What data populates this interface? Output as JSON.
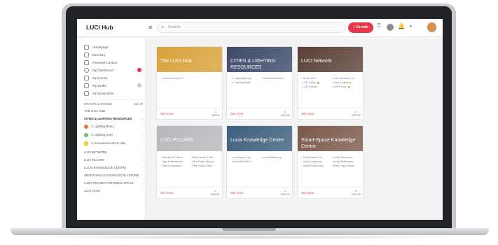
{
  "header": {
    "brand": "LUCI Hub",
    "search_placeholder": "Search",
    "create_label": "+ Create"
  },
  "sidebar": {
    "nav": [
      {
        "label": "Homepage"
      },
      {
        "label": "Directory"
      },
      {
        "label": "Personal Content"
      },
      {
        "label": "My Dashboard"
      },
      {
        "label": "My Events"
      },
      {
        "label": "My Drafts"
      },
      {
        "label": "My Bookmarks"
      }
    ],
    "groups_header": "GROUPS & SPACES",
    "groups_see_all": "See All",
    "groups": [
      {
        "label": "THE LUCI HUB"
      },
      {
        "label": "CITIES & LIGHTING RESOURCES"
      },
      {
        "label": "1. Lighting library"
      },
      {
        "label": "2. Lighting news"
      },
      {
        "label": "3. Announcements & calls"
      },
      {
        "label": "LUCI NETWORK"
      },
      {
        "label": "LUCI PILLARS"
      },
      {
        "label": "LUCIA KNOWLEDGE CENTRE"
      },
      {
        "label": "SMART-SPACE KNOWLEDGE CENTRE"
      },
      {
        "label": "LAB'S PROJECT INTERNAL SPACE"
      },
      {
        "label": "LUCI TEAM"
      }
    ]
  },
  "cards": [
    {
      "title": "The LUCI Hub",
      "links": [
        "- How to use the LU..."
      ],
      "see_more": "See more",
      "spaces_count": "1",
      "spaces_label": "SPACE",
      "color": "#d8a23b"
    },
    {
      "title": "CITIES & LIGHTING RESOURCES",
      "links": [
        "- 1. Lighting library",
        "- 3. Announcements...",
        "- 2. Lighting news"
      ],
      "see_more": "See more",
      "spaces_count": "3",
      "spaces_label": "SPACES",
      "color": "#3c4a6a"
    },
    {
      "title": "LUCI Network",
      "links": [
        "- About LUCI",
        "- LUCI Executive Co...",
        "- LUCI Lights 🔒",
        "- Cities & Lighting...",
        "- LUCI Events",
        "- LIGHT Team 🔒"
      ],
      "see_more": "See more",
      "spaces_count": "6",
      "spaces_label": "SPACES",
      "color": "#5b4037"
    },
    {
      "title": "LUCI PILLARS",
      "links": [
        "- Pillar Art & Culture",
        "- Pillar Health & Wel...",
        "- Light Festivals Wo...",
        "- Pillar Public Spaces",
        "- Pillar Governance",
        "- Pillar Social Cities..."
      ],
      "see_more": "See more",
      "spaces_count": "6",
      "spaces_label": "SPACES",
      "color": "#b8b8bc"
    },
    {
      "title": "Lucia Knowledge Centre",
      "links": [
        "- Lucia News & pr...",
        "- Lucia Partners sp...",
        "- Lucia Wiki Peer T..."
      ],
      "see_more": "See more",
      "spaces_count": "3",
      "spaces_label": "SPACES",
      "color": "#3d5f7c"
    },
    {
      "title": "Smart-Space Knowledge Centre",
      "links": [
        "- SmSp News & W...",
        "- SmSp Partners w...",
        "- SmSp Constructi...",
        "- SmSp White pape...",
        "- SmSp Project spa...",
        "- White Paper Smart..."
      ],
      "see_more": "See more",
      "spaces_count": "6",
      "spaces_label": "SPACES",
      "color": "#7a5a4a"
    }
  ]
}
